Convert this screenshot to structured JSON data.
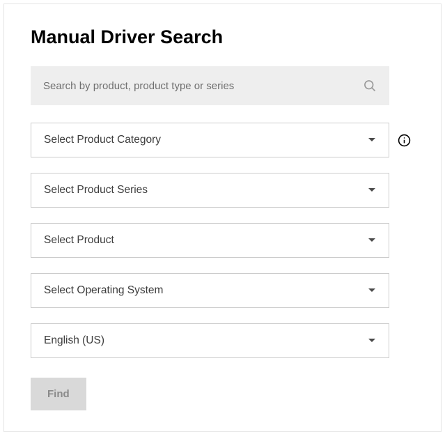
{
  "title": "Manual Driver Search",
  "search": {
    "placeholder": "Search by product, product type or series"
  },
  "selects": {
    "product_category": "Select Product Category",
    "product_series": "Select Product Series",
    "product": "Select Product",
    "operating_system": "Select Operating System",
    "language": "English (US)"
  },
  "find_button": "Find"
}
